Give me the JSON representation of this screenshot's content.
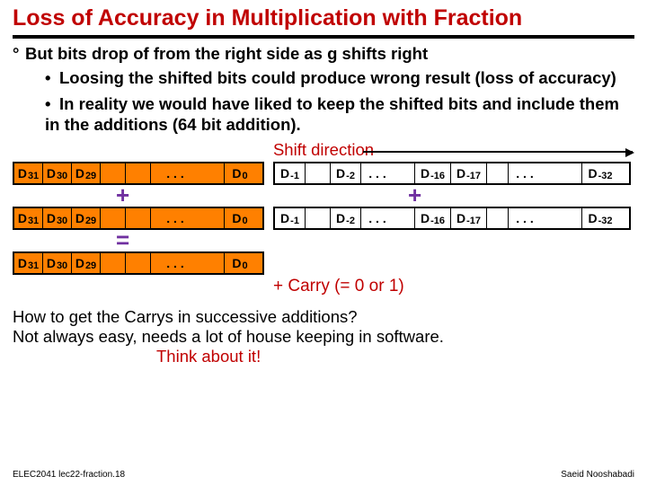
{
  "title": "Loss of Accuracy in Multiplication with Fraction",
  "bullets": {
    "b1_pre": "But bits drop of from the right side as ",
    "b1_u": "g",
    "b1_post": " shifts right",
    "b2a": "Loosing the shifted bits could produce wrong result (loss of accuracy)",
    "b2b": "In reality we would have liked to keep the shifted bits and include them in the additions (64 bit addition)."
  },
  "shift_dir": "Shift direction",
  "ops": {
    "plus": "+",
    "eq": "="
  },
  "bits": {
    "d31": "D",
    "s31": "31",
    "d30": "D",
    "s30": "30",
    "d29": "D",
    "s29": "29",
    "d0": "D",
    "s0": "0",
    "dm1": "D",
    "sm1": "-1",
    "dm2": "D",
    "sm2": "-2",
    "dm16": "D",
    "sm16": "-16",
    "dm17": "D",
    "sm17": "-17",
    "dm32": "D",
    "sm32": "-32",
    "dots": ". . .",
    "dots2": ". . ."
  },
  "carry": "+ Carry (= 0 or 1)",
  "q1": "How to get the Carrys in successive additions?",
  "q2": "Not always easy, needs a lot of house keeping in software.",
  "think": "Think about it!",
  "footer_left": "ELEC2041  lec22-fraction.18",
  "footer_right": "Saeid Nooshabadi"
}
